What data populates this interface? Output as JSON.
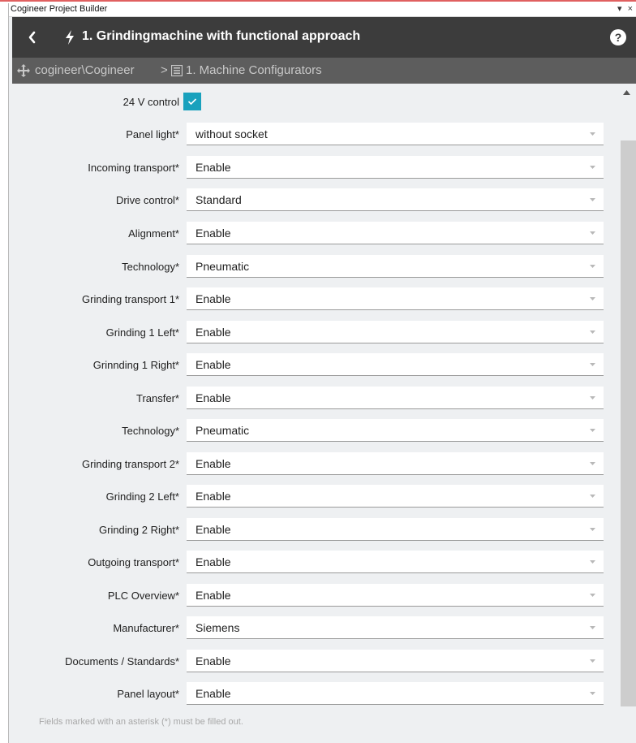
{
  "window": {
    "title": "Cogineer Project Builder",
    "pin": "▾",
    "close": "×"
  },
  "header": {
    "title": "1. Grindingmachine with functional approach",
    "help": "?"
  },
  "breadcrumb": {
    "root": "cogineer\\Cogineer",
    "separator": ">",
    "current": "1. Machine Configurators"
  },
  "form": {
    "checkbox": {
      "label": "24 V control",
      "checked": true
    },
    "fields": [
      {
        "label": "Panel light*",
        "value": "without socket"
      },
      {
        "label": "Incoming transport*",
        "value": "Enable"
      },
      {
        "label": "Drive control*",
        "value": "Standard"
      },
      {
        "label": "Alignment*",
        "value": "Enable"
      },
      {
        "label": "Technology*",
        "value": "Pneumatic"
      },
      {
        "label": "Grinding transport 1*",
        "value": "Enable"
      },
      {
        "label": "Grinding 1 Left*",
        "value": "Enable"
      },
      {
        "label": "Grinnding 1 Right*",
        "value": "Enable"
      },
      {
        "label": "Transfer*",
        "value": "Enable"
      },
      {
        "label": "Technology*",
        "value": "Pneumatic"
      },
      {
        "label": "Grinding transport 2*",
        "value": "Enable"
      },
      {
        "label": "Grinding 2 Left*",
        "value": "Enable"
      },
      {
        "label": "Grinding 2 Right*",
        "value": "Enable"
      },
      {
        "label": "Outgoing transport*",
        "value": "Enable"
      },
      {
        "label": "PLC Overview*",
        "value": "Enable"
      },
      {
        "label": "Manufacturer*",
        "value": "Siemens"
      },
      {
        "label": "Documents / Standards*",
        "value": "Enable"
      },
      {
        "label": "Panel layout*",
        "value": "Enable"
      }
    ],
    "footnote": "Fields marked with an asterisk (*) must be filled out."
  },
  "icons": {
    "back": "chevron-left-icon",
    "bolt": "lightning-icon",
    "help": "help-icon",
    "breadcrumb_root": "move-icon",
    "breadcrumb_current": "list-icon",
    "checkbox": "checkmark-icon",
    "dropdown": "caret-down-icon",
    "scroll_up": "caret-up-icon"
  },
  "colors": {
    "header_bg": "#3c3c3c",
    "breadcrumb_bg": "#5d5d5d",
    "accent": "#19a1bd",
    "content_bg": "#eef0f2"
  }
}
